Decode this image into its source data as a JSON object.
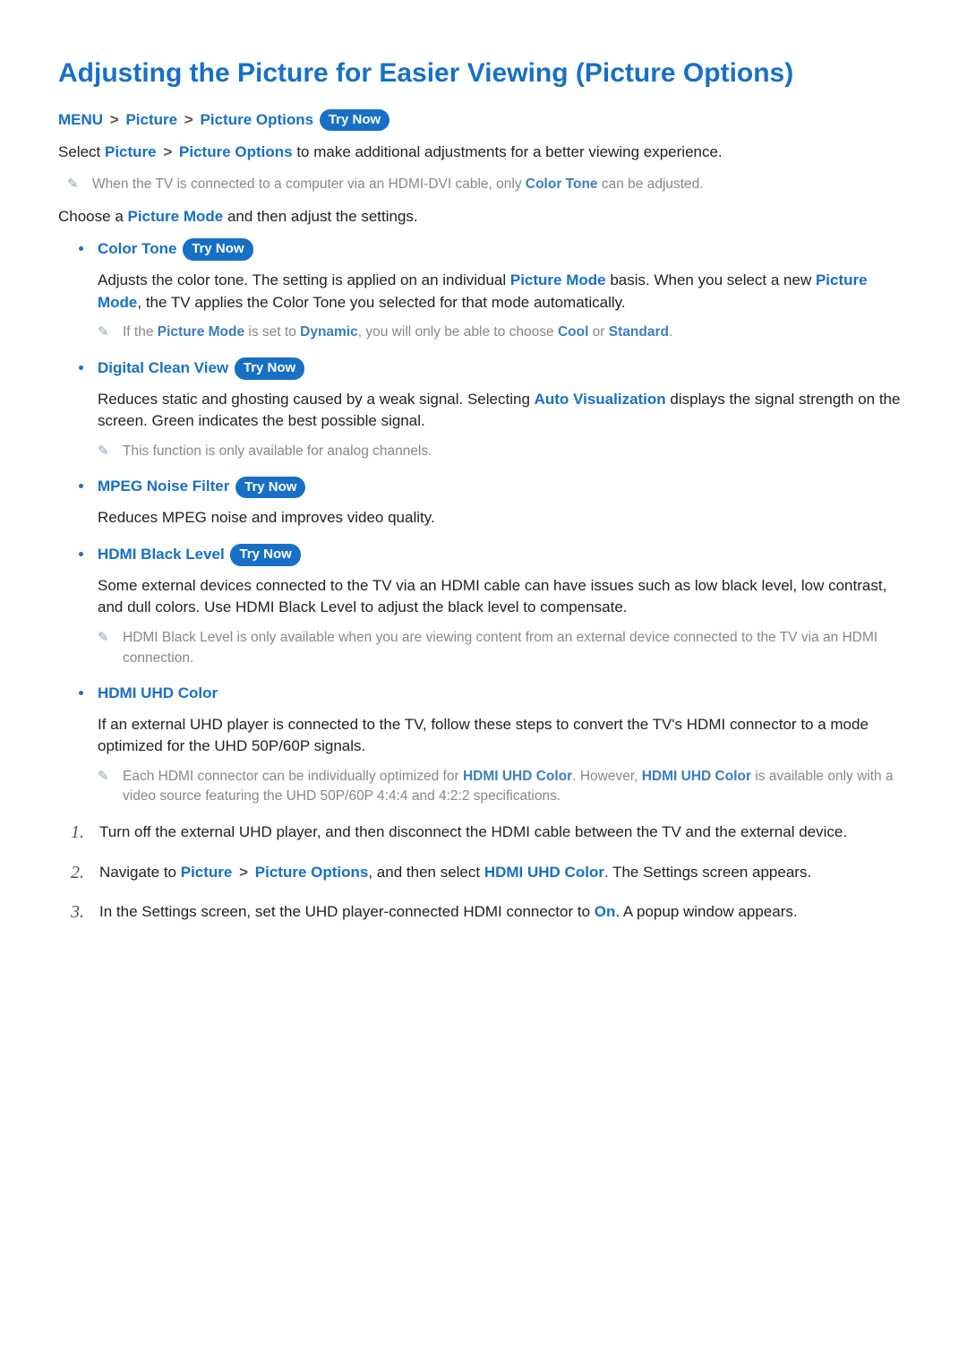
{
  "title": "Adjusting the Picture for Easier Viewing (Picture Options)",
  "breadcrumb": {
    "menu": "MENU",
    "picture": "Picture",
    "pictureOptions": "Picture Options",
    "tryNow": "Try Now"
  },
  "intro": {
    "prefix": "Select ",
    "picture": "Picture",
    "pictureOptions": "Picture Options",
    "suffix": " to make additional adjustments for a better viewing experience."
  },
  "topNote": {
    "pre": "When the TV is connected to a computer via an HDMI-DVI cable, only ",
    "link": "Color Tone",
    "post": " can be adjusted."
  },
  "choose": {
    "pre": "Choose a ",
    "link": "Picture Mode",
    "post": " and then adjust the settings."
  },
  "opts": {
    "colorTone": {
      "title": "Color Tone",
      "tryNow": "Try Now",
      "p1a": "Adjusts the color tone. The setting is applied on an individual ",
      "p1link1": "Picture Mode",
      "p1b": " basis. When you select a new ",
      "p1link2": "Picture Mode",
      "p1c": ", the TV applies the Color Tone you selected for that mode automatically.",
      "note": {
        "a": "If the ",
        "l1": "Picture Mode",
        "b": " is set to ",
        "l2": "Dynamic",
        "c": ", you will only be able to choose ",
        "l3": "Cool",
        "d": " or ",
        "l4": "Standard",
        "e": "."
      }
    },
    "dcv": {
      "title": "Digital Clean View",
      "tryNow": "Try Now",
      "p1a": "Reduces static and ghosting caused by a weak signal. Selecting ",
      "l1": "Auto Visualization",
      "p1b": " displays the signal strength on the screen. Green indicates the best possible signal.",
      "note": "This function is only available for analog channels."
    },
    "mpeg": {
      "title": "MPEG Noise Filter",
      "tryNow": "Try Now",
      "desc": "Reduces MPEG noise and improves video quality."
    },
    "hdmiBlack": {
      "title": "HDMI Black Level",
      "tryNow": "Try Now",
      "desc": "Some external devices connected to the TV via an HDMI cable can have issues such as low black level, low contrast, and dull colors. Use HDMI Black Level to adjust the black level to compensate.",
      "note": "HDMI Black Level is only available when you are viewing content from an external device connected to the TV via an HDMI connection."
    },
    "hdmiUhd": {
      "title": "HDMI UHD Color",
      "desc": "If an external UHD player is connected to the TV, follow these steps to convert the TV's HDMI connector to a mode optimized for the UHD 50P/60P signals.",
      "note": {
        "a": "Each HDMI connector can be individually optimized for ",
        "l1": "HDMI UHD Color",
        "b": ". However, ",
        "l2": "HDMI UHD Color",
        "c": " is available only with a video source featuring the UHD 50P/60P 4:4:4 and 4:2:2 specifications."
      }
    }
  },
  "steps": {
    "s1": "Turn off the external UHD player, and then disconnect the HDMI cable between the TV and the external device.",
    "s2a": "Navigate to ",
    "s2l1": "Picture",
    "s2l2": "Picture Options",
    "s2b": ", and then select ",
    "s2l3": "HDMI UHD Color",
    "s2c": ". The Settings screen appears.",
    "s3a": "In the Settings screen, set the UHD player-connected HDMI connector to ",
    "s3l1": "On",
    "s3b": ". A popup window appears."
  }
}
